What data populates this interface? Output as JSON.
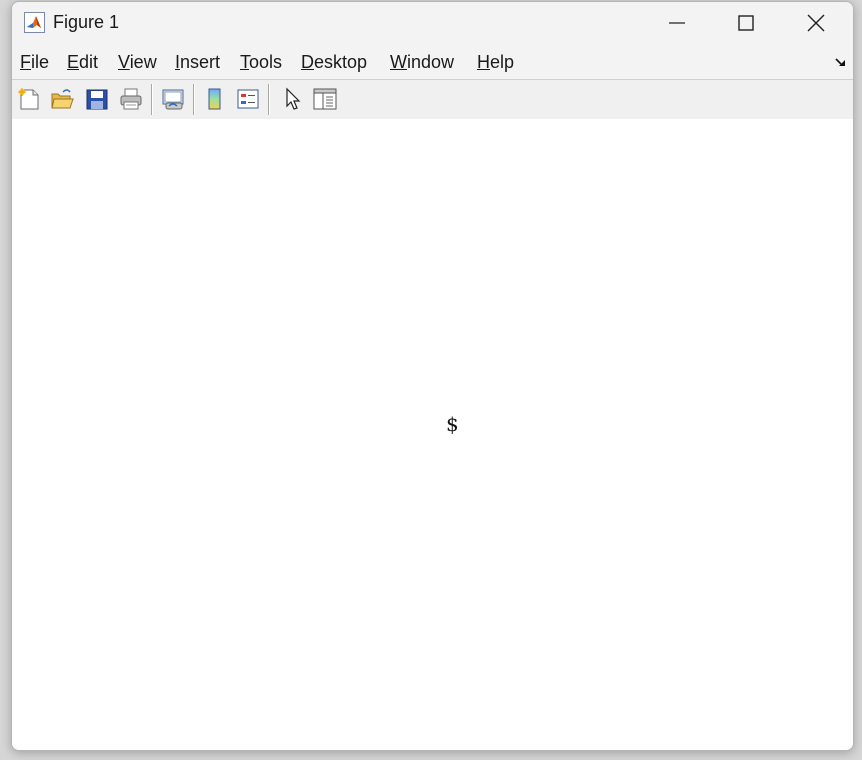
{
  "window": {
    "title": "Figure 1",
    "buttons": {
      "minimize_icon": "minimize-icon",
      "maximize_icon": "maximize-icon",
      "close_icon": "close-icon"
    }
  },
  "menubar": {
    "items": [
      {
        "key": "F",
        "rest": "ile"
      },
      {
        "key": "E",
        "rest": "dit"
      },
      {
        "key": "V",
        "rest": "iew"
      },
      {
        "key": "I",
        "rest": "nsert"
      },
      {
        "key": "T",
        "rest": "ools"
      },
      {
        "key": "D",
        "rest": "esktop"
      },
      {
        "key": "W",
        "rest": "indow"
      },
      {
        "key": "H",
        "rest": "elp"
      }
    ]
  },
  "toolbar": {
    "tools": [
      "new-figure-icon",
      "open-file-icon",
      "save-icon",
      "print-icon",
      "link-plot-icon",
      "insert-colorbar-icon",
      "insert-legend-icon",
      "edit-plot-arrow-icon",
      "property-inspector-icon"
    ]
  },
  "canvas": {
    "text": "$"
  },
  "colors": {
    "window_bg": "#f0f0f0",
    "canvas_bg": "#ffffff"
  }
}
